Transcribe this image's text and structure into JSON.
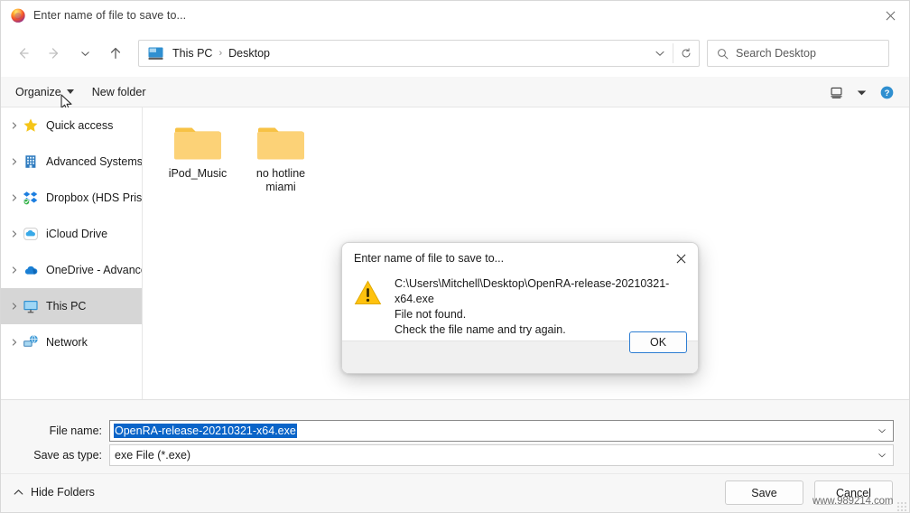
{
  "window": {
    "title": "Enter name of file to save to...",
    "app_icon": "firefox-icon",
    "close_label": "✕"
  },
  "nav": {
    "back_icon": "arrow-left-icon",
    "forward_icon": "arrow-right-icon",
    "recent_icon": "chevron-down-icon",
    "up_icon": "arrow-up-icon",
    "address": {
      "pc_icon": "this-pc-icon",
      "crumbs": [
        "This PC",
        "Desktop"
      ],
      "separator": "›",
      "dropdown_icon": "chevron-down-icon",
      "refresh_icon": "refresh-icon"
    },
    "search": {
      "icon": "search-icon",
      "placeholder": "Search Desktop"
    }
  },
  "commandbar": {
    "organize_label": "Organize",
    "new_folder_label": "New folder",
    "view_icon": "view-layout-icon",
    "view_caret_icon": "chevron-down-icon",
    "help_icon": "help-icon"
  },
  "sidebar": {
    "items": [
      {
        "label": "Quick access",
        "icon": "star-icon",
        "selected": false
      },
      {
        "label": "Advanced Systems [",
        "icon": "building-icon",
        "selected": false
      },
      {
        "label": "Dropbox (HDS Prism",
        "icon": "dropbox-icon",
        "selected": false
      },
      {
        "label": "iCloud Drive",
        "icon": "icloud-icon",
        "selected": false
      },
      {
        "label": "OneDrive - Advance",
        "icon": "onedrive-icon",
        "selected": false
      },
      {
        "label": "This PC",
        "icon": "monitor-icon",
        "selected": true
      },
      {
        "label": "Network",
        "icon": "network-icon",
        "selected": false
      }
    ],
    "expander_icon": "chevron-right-icon"
  },
  "filepane": {
    "items": [
      {
        "label": "iPod_Music",
        "icon": "folder-icon"
      },
      {
        "label": "no hotline miami",
        "icon": "folder-icon"
      }
    ]
  },
  "form": {
    "filename_label": "File name:",
    "filename_value": "OpenRA-release-20210321-x64.exe",
    "savetype_label": "Save as type:",
    "savetype_value": "exe File (*.exe)",
    "dropdown_icon": "chevron-down-icon",
    "selection_color": "#0a64c8"
  },
  "footer": {
    "hide_folders_label": "Hide Folders",
    "hide_folders_icon": "chevron-up-icon",
    "save_label": "Save",
    "cancel_label": "Cancel"
  },
  "dialog": {
    "title": "Enter name of file to save to...",
    "close_icon": "close-icon",
    "warning_icon": "warning-triangle-icon",
    "message_lines": [
      "C:\\Users\\Mitchell\\Desktop\\OpenRA-release-20210321-x64.exe",
      "File not found.",
      "Check the file name and try again."
    ],
    "ok_label": "OK",
    "accent_color": "#2d7dd2",
    "warning_color": "#ffc20e"
  },
  "watermark": {
    "text": "www.989214.com"
  }
}
